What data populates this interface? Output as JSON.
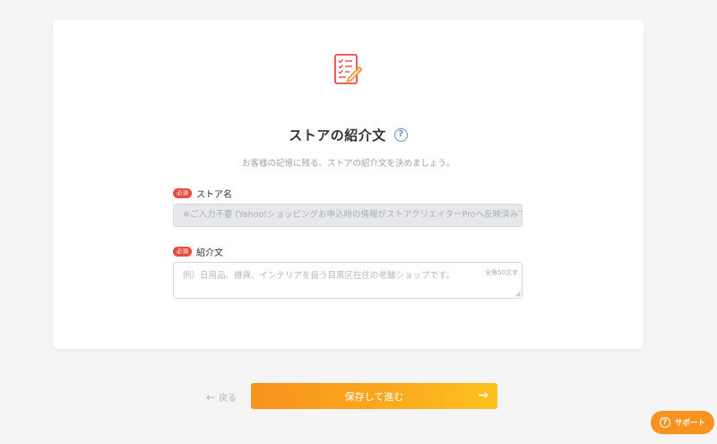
{
  "header": {
    "title": "ストアの紹介文",
    "help_icon": "?",
    "description": "お客様の記憶に残る、ストアの紹介文を決めましょう。"
  },
  "fields": {
    "store_name": {
      "required_badge": "必須",
      "label": "ストア名",
      "placeholder": "※ご入力不要 (Yahoo!ショッピングお申込時の情報がストアクリエイターProへ反映済みです)"
    },
    "introduction": {
      "required_badge": "必須",
      "label": "紹介文",
      "placeholder": "例）日用品、雑貨、インテリアを扱う目黒区在住の老舗ショップです。",
      "counter": "全角50文字"
    }
  },
  "footer": {
    "back_label": "戻る",
    "save_label": "保存して進む"
  },
  "support": {
    "icon": "?",
    "label": "サポート"
  },
  "colors": {
    "accent": "#f7931e",
    "required": "#e84b3c",
    "icon_red": "#e94b49"
  },
  "icons": {
    "hero": "document-checklist-pen-icon",
    "help": "question-circle-icon",
    "back": "arrow-left-icon",
    "save": "arrow-right-icon",
    "support": "question-circle-icon"
  }
}
